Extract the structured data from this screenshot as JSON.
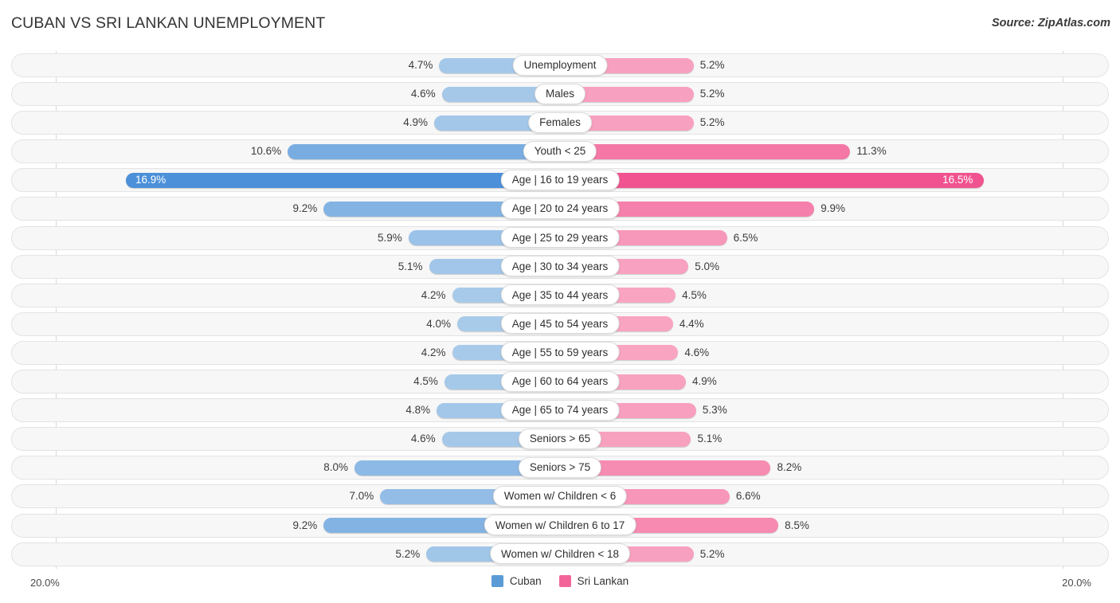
{
  "header": {
    "title": "CUBAN VS SRI LANKAN UNEMPLOYMENT",
    "source": "Source: ZipAtlas.com"
  },
  "axis": {
    "left_label": "20.0%",
    "right_label": "20.0%",
    "max": 20.0
  },
  "legend": {
    "items": [
      {
        "label": "Cuban",
        "color": "#5b9bd5"
      },
      {
        "label": "Sri Lankan",
        "color": "#f2659b"
      }
    ]
  },
  "chart_data": {
    "type": "bar",
    "orientation": "diverging-horizontal",
    "title": "CUBAN VS SRI LANKAN UNEMPLOYMENT",
    "xlabel": "",
    "ylabel": "",
    "xlim": [
      20.0,
      20.0
    ],
    "grid": false,
    "legend_position": "bottom-center",
    "unit": "%",
    "categories": [
      "Unemployment",
      "Males",
      "Females",
      "Youth < 25",
      "Age | 16 to 19 years",
      "Age | 20 to 24 years",
      "Age | 25 to 29 years",
      "Age | 30 to 34 years",
      "Age | 35 to 44 years",
      "Age | 45 to 54 years",
      "Age | 55 to 59 years",
      "Age | 60 to 64 years",
      "Age | 65 to 74 years",
      "Seniors > 65",
      "Seniors > 75",
      "Women w/ Children < 6",
      "Women w/ Children 6 to 17",
      "Women w/ Children < 18"
    ],
    "series": [
      {
        "name": "Cuban",
        "side": "left",
        "color": "#5b9bd5",
        "values": [
          4.7,
          4.6,
          4.9,
          10.6,
          16.9,
          9.2,
          5.9,
          5.1,
          4.2,
          4.0,
          4.2,
          4.5,
          4.8,
          4.6,
          8.0,
          7.0,
          9.2,
          5.2
        ],
        "labels": [
          "4.7%",
          "4.6%",
          "4.9%",
          "10.6%",
          "16.9%",
          "9.2%",
          "5.9%",
          "5.1%",
          "4.2%",
          "4.0%",
          "4.2%",
          "4.5%",
          "4.8%",
          "4.6%",
          "8.0%",
          "7.0%",
          "9.2%",
          "5.2%"
        ]
      },
      {
        "name": "Sri Lankan",
        "side": "right",
        "color": "#f2659b",
        "values": [
          5.2,
          5.2,
          5.2,
          11.3,
          16.5,
          9.9,
          6.5,
          5.0,
          4.5,
          4.4,
          4.6,
          4.9,
          5.3,
          5.1,
          8.2,
          6.6,
          8.5,
          5.2
        ],
        "labels": [
          "5.2%",
          "5.2%",
          "5.2%",
          "11.3%",
          "16.5%",
          "9.9%",
          "6.5%",
          "5.0%",
          "4.5%",
          "4.4%",
          "4.6%",
          "4.9%",
          "5.3%",
          "5.1%",
          "8.2%",
          "6.6%",
          "8.5%",
          "5.2%"
        ]
      }
    ]
  }
}
